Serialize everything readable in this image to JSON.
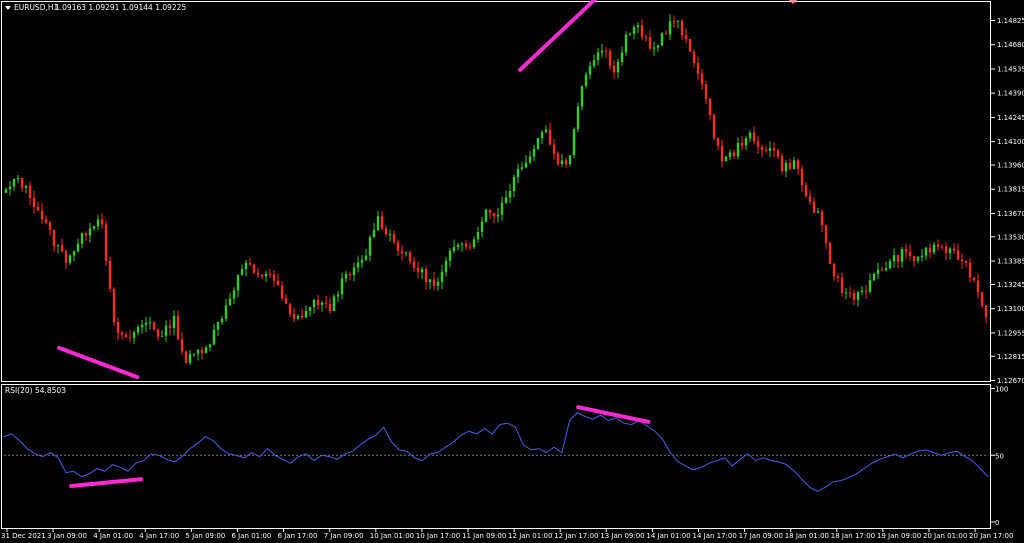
{
  "header": {
    "symbol_label": "EURUSD,H1",
    "ohlc": "1.09163 1.09291 1.09144 1.09225"
  },
  "indicator": {
    "label": "RSI(20) 54.8503",
    "levels": [
      "100",
      "50",
      "0"
    ]
  },
  "colors": {
    "background": "#000000",
    "bull": "#32cd32",
    "bear": "#ff2a2a",
    "rsi_line": "#4a5ee8",
    "annotation": "#ff2ad4",
    "axis": "#ffffff"
  },
  "chart_data": [
    {
      "type": "candlestick",
      "title": "EURUSD,H1",
      "ylim": [
        1.1267,
        1.1496
      ],
      "y_ticks": [
        "1.14825",
        "1.14680",
        "1.14535",
        "1.14390",
        "1.14245",
        "1.14100",
        "1.13960",
        "1.13815",
        "1.13670",
        "1.13530",
        "1.13385",
        "1.13245",
        "1.13100",
        "1.12955",
        "1.12815",
        "1.12670"
      ],
      "x_ticks": [
        "31 Dec 2021",
        "3 Jan 09:00",
        "4 Jan 01:00",
        "4 Jan 17:00",
        "5 Jan 09:00",
        "6 Jan 01:00",
        "6 Jan 17:00",
        "7 Jan 09:00",
        "10 Jan 01:00",
        "10 Jan 17:00",
        "11 Jan 09:00",
        "12 Jan 01:00",
        "12 Jan 17:00",
        "13 Jan 09:00",
        "14 Jan 01:00",
        "14 Jan 17:00",
        "17 Jan 09:00",
        "18 Jan 01:00",
        "18 Jan 17:00",
        "19 Jan 09:00",
        "20 Jan 01:00",
        "20 Jan 17:00"
      ],
      "close_path": [
        1.138,
        1.1388,
        1.1378,
        1.1365,
        1.135,
        1.134,
        1.1348,
        1.136,
        1.1365,
        1.13,
        1.129,
        1.1298,
        1.1303,
        1.1292,
        1.1305,
        1.1278,
        1.1284,
        1.129,
        1.1305,
        1.1322,
        1.1338,
        1.1328,
        1.1333,
        1.1318,
        1.1302,
        1.1308,
        1.1315,
        1.1309,
        1.1325,
        1.1332,
        1.134,
        1.1365,
        1.1355,
        1.1345,
        1.1336,
        1.133,
        1.1322,
        1.134,
        1.1352,
        1.1348,
        1.1368,
        1.1366,
        1.138,
        1.1396,
        1.1403,
        1.142,
        1.14,
        1.1395,
        1.144,
        1.146,
        1.1466,
        1.1452,
        1.1475,
        1.1478,
        1.1463,
        1.1475,
        1.1484,
        1.1467,
        1.1452,
        1.142,
        1.1398,
        1.1404,
        1.1415,
        1.1405,
        1.1408,
        1.1394,
        1.1398,
        1.1376,
        1.1365,
        1.1336,
        1.132,
        1.1318,
        1.1323,
        1.1332,
        1.1338,
        1.1343,
        1.134,
        1.1344,
        1.1348,
        1.1343,
        1.134,
        1.1327,
        1.1307
      ],
      "annotations": [
        {
          "name": "price-low-trendline",
          "from": [
            "3 Jan 09:00",
            1.12865
          ],
          "to": [
            "4 Jan 17:00",
            1.1269
          ]
        },
        {
          "name": "price-high-trendline",
          "from": [
            "12 Jan 01:00",
            1.1453
          ],
          "to": [
            "13 Jan 09:00",
            1.1497
          ]
        }
      ]
    },
    {
      "type": "line",
      "title": "RSI(20) 54.8503",
      "ylim": [
        0,
        100
      ],
      "y_ticks": [
        "100",
        "50",
        "0"
      ],
      "reference_line": 50,
      "values": [
        64,
        66,
        61,
        55,
        51,
        49,
        52,
        48,
        37,
        38,
        34,
        36,
        40,
        38,
        43,
        41,
        38,
        44,
        46,
        51,
        50,
        47,
        45,
        49,
        55,
        59,
        64,
        61,
        55,
        51,
        50,
        48,
        52,
        49,
        55,
        50,
        47,
        44,
        49,
        51,
        46,
        50,
        49,
        47,
        51,
        53,
        58,
        62,
        65,
        71,
        60,
        54,
        53,
        48,
        46,
        51,
        52,
        56,
        60,
        65,
        68,
        66,
        70,
        66,
        73,
        74,
        71,
        58,
        54,
        55,
        52,
        56,
        52,
        76,
        82,
        79,
        77,
        80,
        76,
        78,
        74,
        73,
        76,
        72,
        68,
        62,
        52,
        45,
        42,
        39,
        41,
        44,
        46,
        48,
        42,
        47,
        51,
        46,
        48,
        46,
        45,
        43,
        38,
        32,
        26,
        23,
        26,
        30,
        31,
        33,
        36,
        40,
        44,
        47,
        49,
        51,
        48,
        51,
        53,
        54,
        52,
        50,
        52,
        53,
        49,
        46,
        40,
        34
      ],
      "annotations": [
        {
          "name": "rsi-low-trendline",
          "from": [
            "3 Jan 09:00",
            27
          ],
          "to": [
            "4 Jan 17:00",
            32
          ]
        },
        {
          "name": "rsi-high-trendline",
          "from": [
            "12 Jan 17:00",
            86
          ],
          "to": [
            "14 Jan 01:00",
            75
          ]
        }
      ]
    }
  ]
}
